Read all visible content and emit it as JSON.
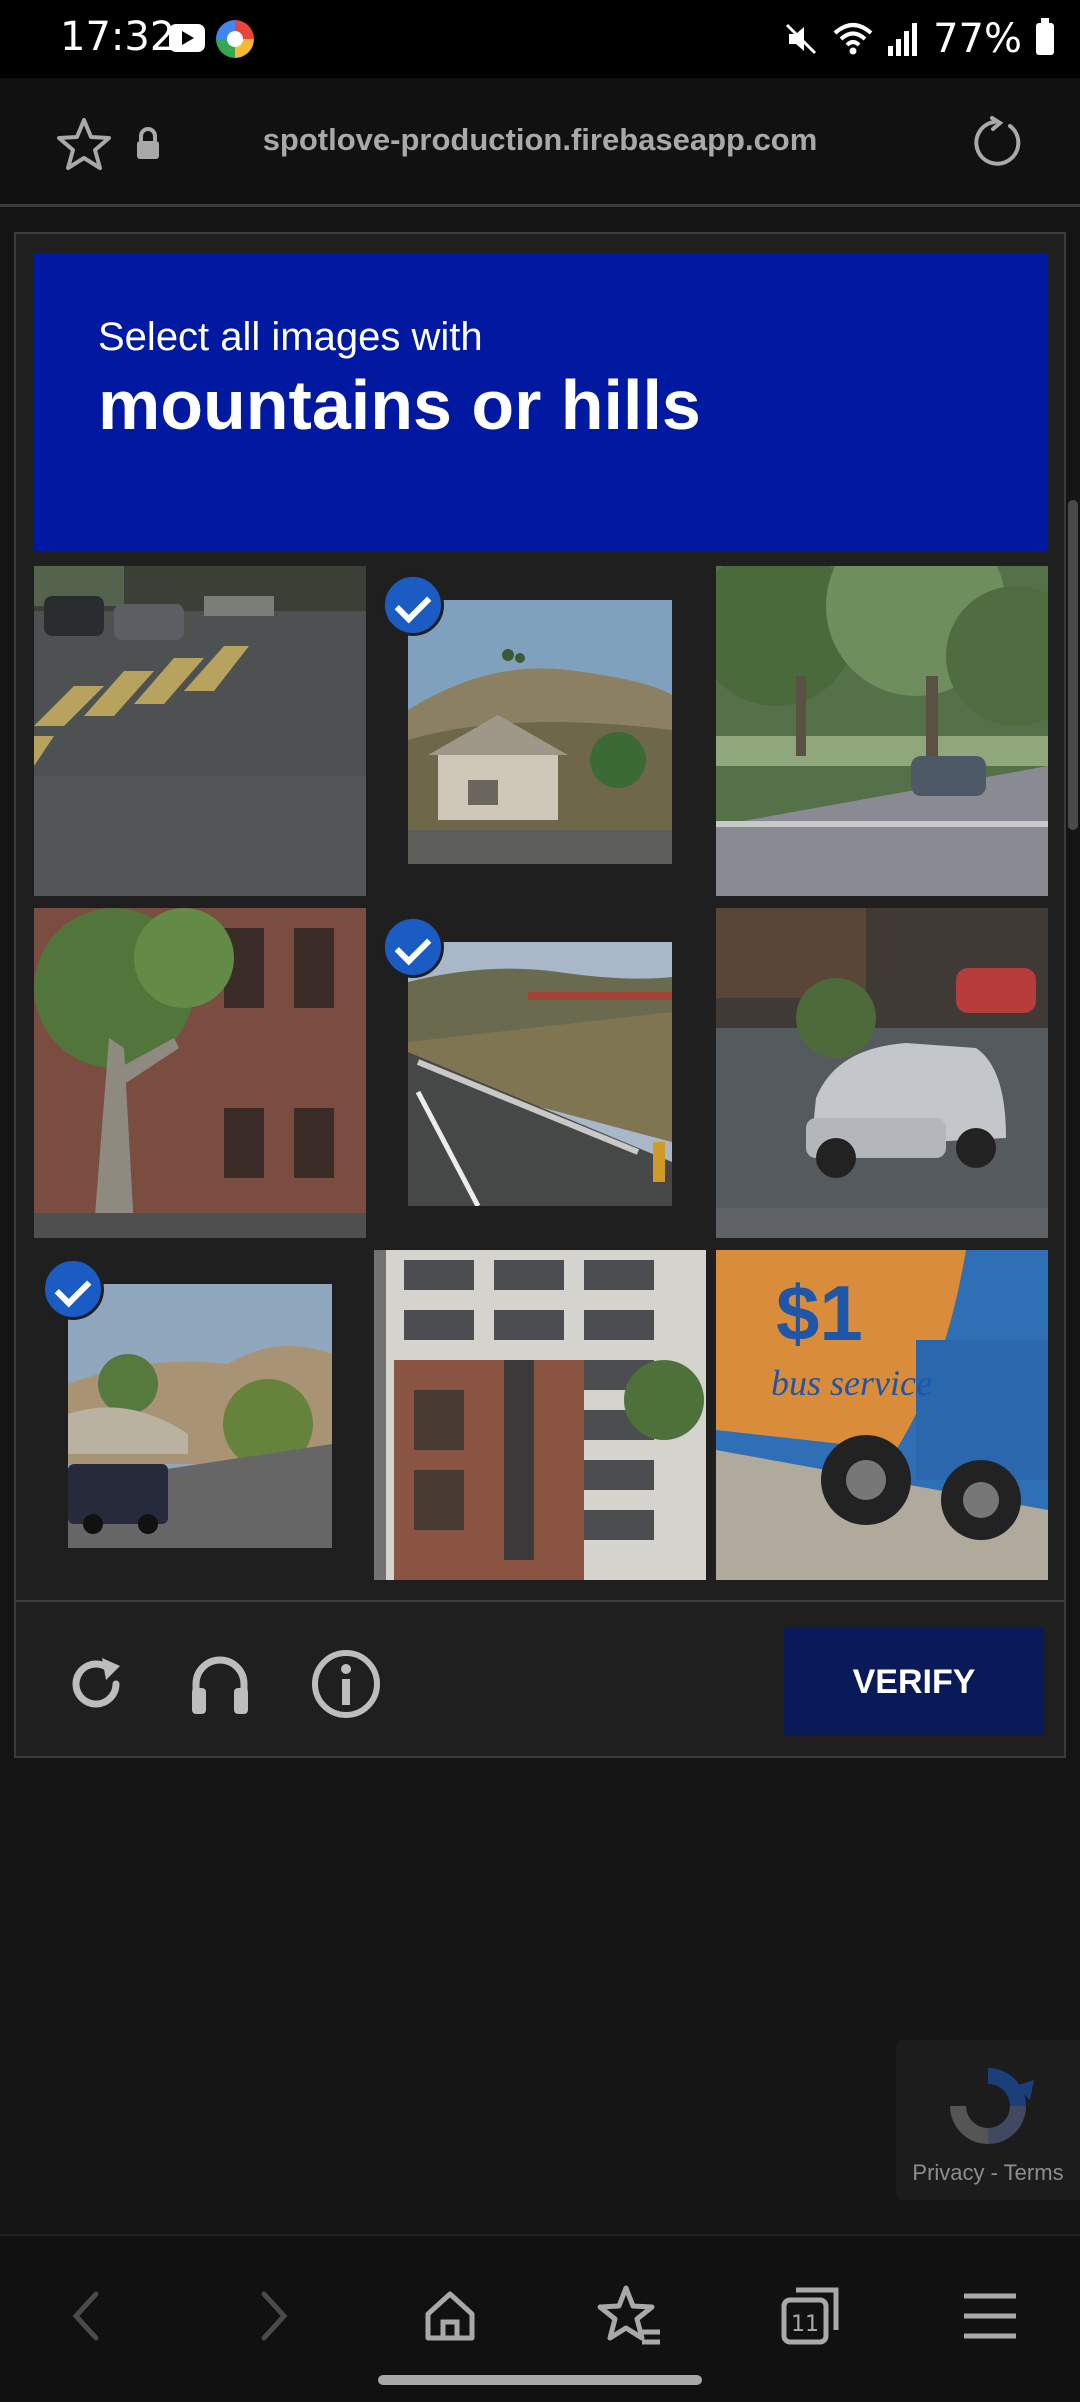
{
  "status_bar": {
    "time": "17:32",
    "battery": "77%",
    "icons": [
      "youtube-icon",
      "app-icon",
      "mute-icon",
      "wifi-icon",
      "signal-icon",
      "battery-icon"
    ]
  },
  "browser": {
    "url": "spotlove-production.firebaseapp.com"
  },
  "captcha": {
    "instruction_small": "Select all images with",
    "instruction_big": "mountains or hills",
    "verify_label": "VERIFY",
    "tiles": [
      {
        "scene": "crosswalk-street",
        "selected": false
      },
      {
        "scene": "hillside-houses",
        "selected": true
      },
      {
        "scene": "tree-lined-road",
        "selected": false
      },
      {
        "scene": "brick-building-tree",
        "selected": false
      },
      {
        "scene": "highway-hills",
        "selected": true
      },
      {
        "scene": "silver-car",
        "selected": false
      },
      {
        "scene": "hills-van",
        "selected": true
      },
      {
        "scene": "office-buildings",
        "selected": false
      },
      {
        "scene": "blue-bus",
        "selected": false
      }
    ],
    "bus_text": "$1",
    "bus_subtext": "bus service"
  },
  "recaptcha": {
    "privacy_label": "Privacy - Terms"
  },
  "colors": {
    "header_blue": "#0019a0",
    "verify_bg": "#0a1a58",
    "check_blue": "#1b5bc4"
  }
}
